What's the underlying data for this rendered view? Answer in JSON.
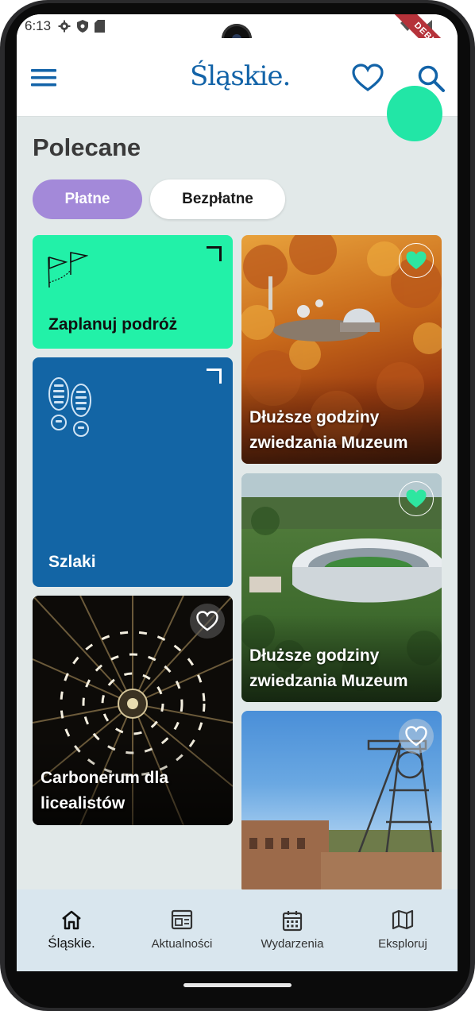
{
  "status": {
    "time": "6:13",
    "debug_label": "DEBUG"
  },
  "appbar": {
    "logo": "Śląskie.",
    "menu_icon": "hamburger-menu-icon",
    "favorites_icon": "heart-outline-icon",
    "search_icon": "search-icon"
  },
  "page": {
    "title": "Polecane"
  },
  "filters": {
    "paid": "Płatne",
    "free": "Bezpłatne",
    "selected": "Płatne"
  },
  "cards": {
    "plan": {
      "label": "Zaplanuj podróż",
      "icon": "flags-icon"
    },
    "trails": {
      "label": "Szlaki",
      "icon": "footprints-icon"
    },
    "carbonerum": {
      "label": "Carbonerum dla licealistów",
      "favorite": false
    },
    "museum1": {
      "label": "Dłuższe godziny zwiedzania Muzeum",
      "favorite": true
    },
    "museum2": {
      "label": "Dłuższe godziny zwiedzania Muzeum",
      "favorite": true
    },
    "mine": {
      "label": "",
      "favorite": false
    }
  },
  "bottom_nav": {
    "items": [
      {
        "label": "Śląskie.",
        "icon": "home-icon",
        "active": true
      },
      {
        "label": "Aktualności",
        "icon": "news-icon",
        "active": false
      },
      {
        "label": "Wydarzenia",
        "icon": "calendar-icon",
        "active": false
      },
      {
        "label": "Eksploruj",
        "icon": "map-icon",
        "active": false
      }
    ]
  },
  "colors": {
    "brand_blue": "#1263a8",
    "accent_green": "#22f1a8",
    "chip_purple": "#a389d9",
    "trail_blue": "#1365a5",
    "favorite_green": "#2ee6a0"
  }
}
